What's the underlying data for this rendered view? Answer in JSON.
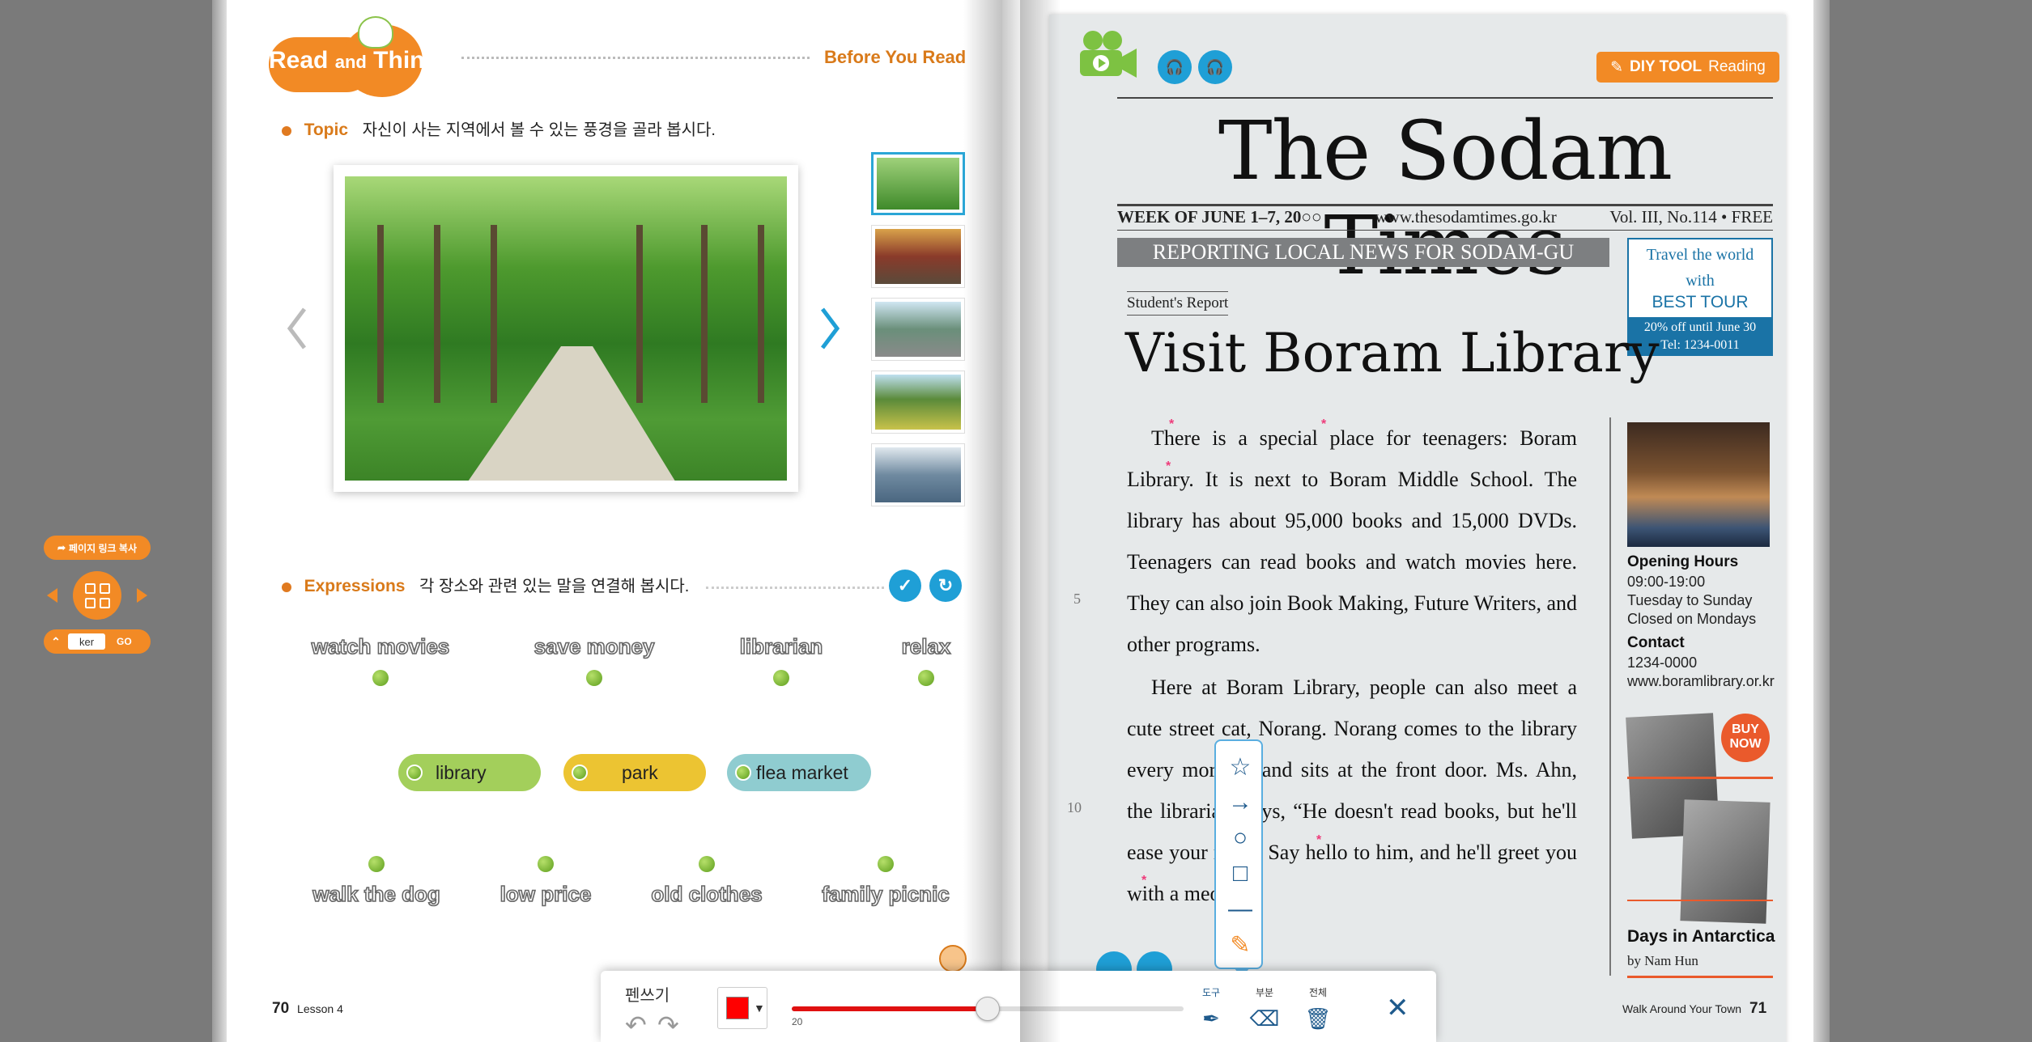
{
  "nav": {
    "copy_link_label": "페이지 링크 복사",
    "page_input_value": "ker",
    "go_label": "GO"
  },
  "left_page": {
    "badge_read": "Read",
    "badge_and": "and",
    "badge_think": "Think",
    "section_label": "Before You Read",
    "topic_label": "Topic",
    "topic_text": "자신이 사는 지역에서 볼 수 있는 풍경을 골라 봅시다.",
    "thumbnails": [
      "park-path",
      "market",
      "street",
      "field",
      "river"
    ],
    "expressions_label": "Expressions",
    "expressions_text": "각 장소와 관련 있는 말을 연결해 봅시다.",
    "top_words": [
      "watch movies",
      "save money",
      "librarian",
      "relax"
    ],
    "pills": [
      {
        "label": "library",
        "color": "#a3cf5b"
      },
      {
        "label": "park",
        "color": "#ecc432"
      },
      {
        "label": "flea market",
        "color": "#8fccd0"
      }
    ],
    "bottom_words": [
      "walk the dog",
      "low price",
      "old clothes",
      "family picnic"
    ],
    "page_number": "70",
    "lesson_label": "Lesson 4"
  },
  "right_page": {
    "diy_bold": "DIY TOOL",
    "diy_text": "Reading",
    "masthead": "The Sodam Times",
    "date": "WEEK OF JUNE 1–7, 20○○",
    "website": "www.thesodamtimes.go.kr",
    "volume": "Vol. III, No.114 • FREE",
    "banner": "REPORTING LOCAL NEWS FOR SODAM-GU",
    "ad_line1": "Travel the world",
    "ad_line2": "with",
    "ad_line3": "BEST TOUR",
    "ad_line4": "20% off until June 30",
    "ad_line5": "Tel: 1234-0011",
    "student_report": "Student's Report",
    "headline": "Visit Boram Library",
    "paragraph1": "There is a special place for teenagers: Boram Library. It is next to Boram Middle School. The library has about 95,000 books and 15,000 DVDs. Teenagers can read books and watch movies here. They can also join Book Making, Future Writers, and other programs.",
    "paragraph2": "Here at Boram Library, people can also meet a cute street cat, Norang. Norang comes to the library every morning and sits at the front door. Ms. Ahn, the librarian, says, “He doesn't read books, but he'll ease your mind. Say hello to him, and he'll greet you with a meow.”",
    "line_no_5": "5",
    "line_no_10": "10",
    "hours_heading": "Opening Hours",
    "hours_time": "09:00-19:00",
    "hours_days": "Tuesday to Sunday",
    "hours_closed": "Closed on Mondays",
    "contact_heading": "Contact",
    "contact_phone": "1234-0000",
    "contact_web": "www.boramlibrary.or.kr",
    "buy_now": "BUY NOW",
    "book_title": "Days in Antarctica",
    "book_author": "by Nam Hun",
    "footer_title": "Walk Around Your Town",
    "page_number": "71"
  },
  "pen_toolbar": {
    "title": "펜쓰기",
    "color": "#ff0000",
    "thickness": 20,
    "thickness_max": 40,
    "tool_label": "도구",
    "partial_label": "부분",
    "all_label": "전체",
    "shape_tools": [
      "star-icon",
      "arrow-icon",
      "circle-icon",
      "square-icon",
      "line-icon",
      "highlighter-icon"
    ]
  }
}
